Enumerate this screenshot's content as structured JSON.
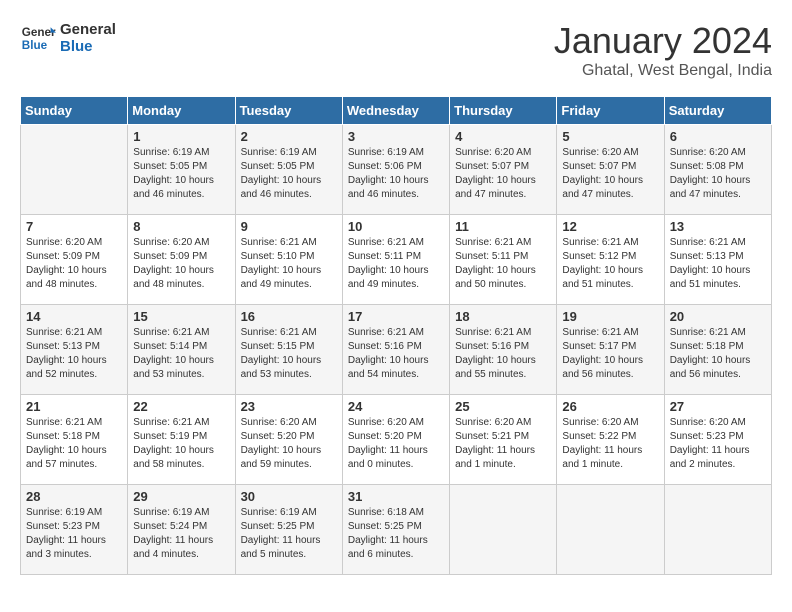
{
  "header": {
    "logo_line1": "General",
    "logo_line2": "Blue",
    "month": "January 2024",
    "location": "Ghatal, West Bengal, India"
  },
  "days_of_week": [
    "Sunday",
    "Monday",
    "Tuesday",
    "Wednesday",
    "Thursday",
    "Friday",
    "Saturday"
  ],
  "weeks": [
    [
      {
        "day": "",
        "info": ""
      },
      {
        "day": "1",
        "info": "Sunrise: 6:19 AM\nSunset: 5:05 PM\nDaylight: 10 hours\nand 46 minutes."
      },
      {
        "day": "2",
        "info": "Sunrise: 6:19 AM\nSunset: 5:05 PM\nDaylight: 10 hours\nand 46 minutes."
      },
      {
        "day": "3",
        "info": "Sunrise: 6:19 AM\nSunset: 5:06 PM\nDaylight: 10 hours\nand 46 minutes."
      },
      {
        "day": "4",
        "info": "Sunrise: 6:20 AM\nSunset: 5:07 PM\nDaylight: 10 hours\nand 47 minutes."
      },
      {
        "day": "5",
        "info": "Sunrise: 6:20 AM\nSunset: 5:07 PM\nDaylight: 10 hours\nand 47 minutes."
      },
      {
        "day": "6",
        "info": "Sunrise: 6:20 AM\nSunset: 5:08 PM\nDaylight: 10 hours\nand 47 minutes."
      }
    ],
    [
      {
        "day": "7",
        "info": "Sunrise: 6:20 AM\nSunset: 5:09 PM\nDaylight: 10 hours\nand 48 minutes."
      },
      {
        "day": "8",
        "info": "Sunrise: 6:20 AM\nSunset: 5:09 PM\nDaylight: 10 hours\nand 48 minutes."
      },
      {
        "day": "9",
        "info": "Sunrise: 6:21 AM\nSunset: 5:10 PM\nDaylight: 10 hours\nand 49 minutes."
      },
      {
        "day": "10",
        "info": "Sunrise: 6:21 AM\nSunset: 5:11 PM\nDaylight: 10 hours\nand 49 minutes."
      },
      {
        "day": "11",
        "info": "Sunrise: 6:21 AM\nSunset: 5:11 PM\nDaylight: 10 hours\nand 50 minutes."
      },
      {
        "day": "12",
        "info": "Sunrise: 6:21 AM\nSunset: 5:12 PM\nDaylight: 10 hours\nand 51 minutes."
      },
      {
        "day": "13",
        "info": "Sunrise: 6:21 AM\nSunset: 5:13 PM\nDaylight: 10 hours\nand 51 minutes."
      }
    ],
    [
      {
        "day": "14",
        "info": "Sunrise: 6:21 AM\nSunset: 5:13 PM\nDaylight: 10 hours\nand 52 minutes."
      },
      {
        "day": "15",
        "info": "Sunrise: 6:21 AM\nSunset: 5:14 PM\nDaylight: 10 hours\nand 53 minutes."
      },
      {
        "day": "16",
        "info": "Sunrise: 6:21 AM\nSunset: 5:15 PM\nDaylight: 10 hours\nand 53 minutes."
      },
      {
        "day": "17",
        "info": "Sunrise: 6:21 AM\nSunset: 5:16 PM\nDaylight: 10 hours\nand 54 minutes."
      },
      {
        "day": "18",
        "info": "Sunrise: 6:21 AM\nSunset: 5:16 PM\nDaylight: 10 hours\nand 55 minutes."
      },
      {
        "day": "19",
        "info": "Sunrise: 6:21 AM\nSunset: 5:17 PM\nDaylight: 10 hours\nand 56 minutes."
      },
      {
        "day": "20",
        "info": "Sunrise: 6:21 AM\nSunset: 5:18 PM\nDaylight: 10 hours\nand 56 minutes."
      }
    ],
    [
      {
        "day": "21",
        "info": "Sunrise: 6:21 AM\nSunset: 5:18 PM\nDaylight: 10 hours\nand 57 minutes."
      },
      {
        "day": "22",
        "info": "Sunrise: 6:21 AM\nSunset: 5:19 PM\nDaylight: 10 hours\nand 58 minutes."
      },
      {
        "day": "23",
        "info": "Sunrise: 6:20 AM\nSunset: 5:20 PM\nDaylight: 10 hours\nand 59 minutes."
      },
      {
        "day": "24",
        "info": "Sunrise: 6:20 AM\nSunset: 5:20 PM\nDaylight: 11 hours\nand 0 minutes."
      },
      {
        "day": "25",
        "info": "Sunrise: 6:20 AM\nSunset: 5:21 PM\nDaylight: 11 hours\nand 1 minute."
      },
      {
        "day": "26",
        "info": "Sunrise: 6:20 AM\nSunset: 5:22 PM\nDaylight: 11 hours\nand 1 minute."
      },
      {
        "day": "27",
        "info": "Sunrise: 6:20 AM\nSunset: 5:23 PM\nDaylight: 11 hours\nand 2 minutes."
      }
    ],
    [
      {
        "day": "28",
        "info": "Sunrise: 6:19 AM\nSunset: 5:23 PM\nDaylight: 11 hours\nand 3 minutes."
      },
      {
        "day": "29",
        "info": "Sunrise: 6:19 AM\nSunset: 5:24 PM\nDaylight: 11 hours\nand 4 minutes."
      },
      {
        "day": "30",
        "info": "Sunrise: 6:19 AM\nSunset: 5:25 PM\nDaylight: 11 hours\nand 5 minutes."
      },
      {
        "day": "31",
        "info": "Sunrise: 6:18 AM\nSunset: 5:25 PM\nDaylight: 11 hours\nand 6 minutes."
      },
      {
        "day": "",
        "info": ""
      },
      {
        "day": "",
        "info": ""
      },
      {
        "day": "",
        "info": ""
      }
    ]
  ]
}
